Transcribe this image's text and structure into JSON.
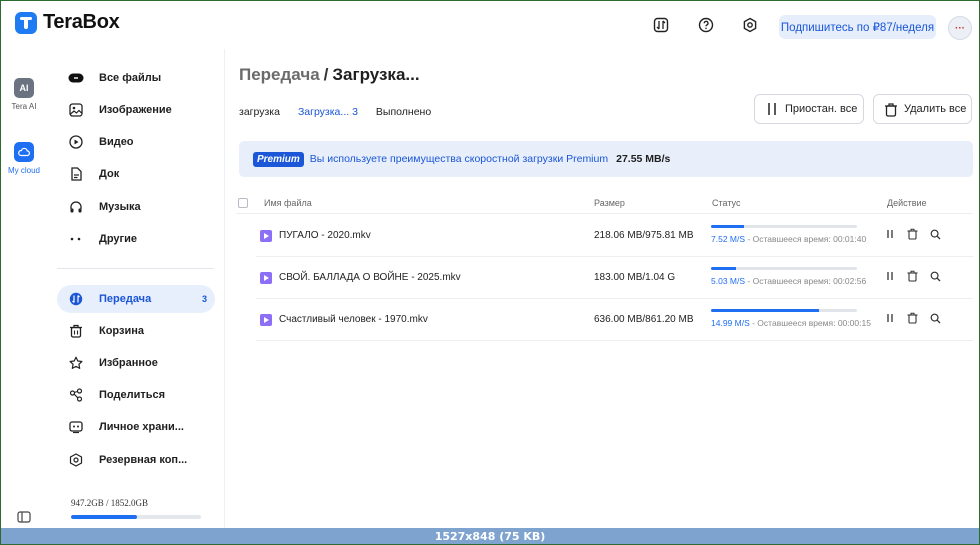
{
  "app": {
    "logo_text": "TeraBox",
    "subscribe_label": "Подпишитесь по ₽87/неделя",
    "avatar_text": "···"
  },
  "rail": {
    "items": [
      {
        "label": "Tera AI",
        "icon": "ai-icon",
        "badge": "AI"
      },
      {
        "label": "My cloud",
        "icon": "cloud-icon"
      }
    ]
  },
  "sidebar": {
    "items": [
      {
        "label": "Все файлы",
        "icon": "all-files-icon"
      },
      {
        "label": "Изображение",
        "icon": "image-icon"
      },
      {
        "label": "Видео",
        "icon": "video-icon"
      },
      {
        "label": "Док",
        "icon": "document-icon"
      },
      {
        "label": "Музыка",
        "icon": "music-icon"
      },
      {
        "label": "Другие",
        "icon": "other-icon"
      },
      {
        "label": "Передача",
        "icon": "transfer-icon",
        "count": "3",
        "active": true
      },
      {
        "label": "Корзина",
        "icon": "trash-icon"
      },
      {
        "label": "Избранное",
        "icon": "star-icon"
      },
      {
        "label": "Поделиться",
        "icon": "share-icon"
      },
      {
        "label": "Личное храни...",
        "icon": "private-storage-icon"
      },
      {
        "label": "Резервная коп...",
        "icon": "backup-icon"
      }
    ],
    "storage": {
      "text": "947.2GB / 1852.0GB",
      "used_fraction": 0.511
    }
  },
  "main": {
    "breadcrumb": {
      "parent": "Передача",
      "separator": "/",
      "current": "Загрузка..."
    },
    "tabs": [
      {
        "label": "загрузка",
        "active": false
      },
      {
        "label": "Загрузка... 3",
        "active": true
      },
      {
        "label": "Выполнено",
        "active": false
      }
    ],
    "actions": {
      "pause_all": "Приостан. все",
      "delete_all": "Удалить все"
    },
    "premium": {
      "badge": "Premium",
      "text": "Вы используете преимущества скоростной загрузки Premium",
      "speed": "27.55 MB/s"
    },
    "table": {
      "headers": {
        "name": "Имя файла",
        "size": "Размер",
        "status": "Статус",
        "action": "Действие"
      },
      "rows": [
        {
          "name": "ПУГАЛО - 2020.mkv",
          "size": "218.06 MB/975.81 MB",
          "progress": 0.2235,
          "speed": "7.52 M/S",
          "remaining": " - Оставшееся время: 00:01:40"
        },
        {
          "name": "СВОЙ. БАЛЛАДА О ВОЙНЕ - 2025.mkv",
          "size": "183.00 MB/1.04 G",
          "progress": 0.172,
          "speed": "5.03 M/S",
          "remaining": " - Оставшееся время: 00:02:56"
        },
        {
          "name": "Счастливый человек - 1970.mkv",
          "size": "636.00 MB/861.20 MB",
          "progress": 0.7385,
          "speed": "14.99 M/S",
          "remaining": " - Оставшееся время: 00:00:15"
        }
      ]
    }
  },
  "footer": {
    "text": "1527x848 (75 KB)"
  },
  "colors": {
    "accent": "#1f6ff2",
    "active_bg": "#e7eefc",
    "video_icon": "#8c6ef7"
  }
}
